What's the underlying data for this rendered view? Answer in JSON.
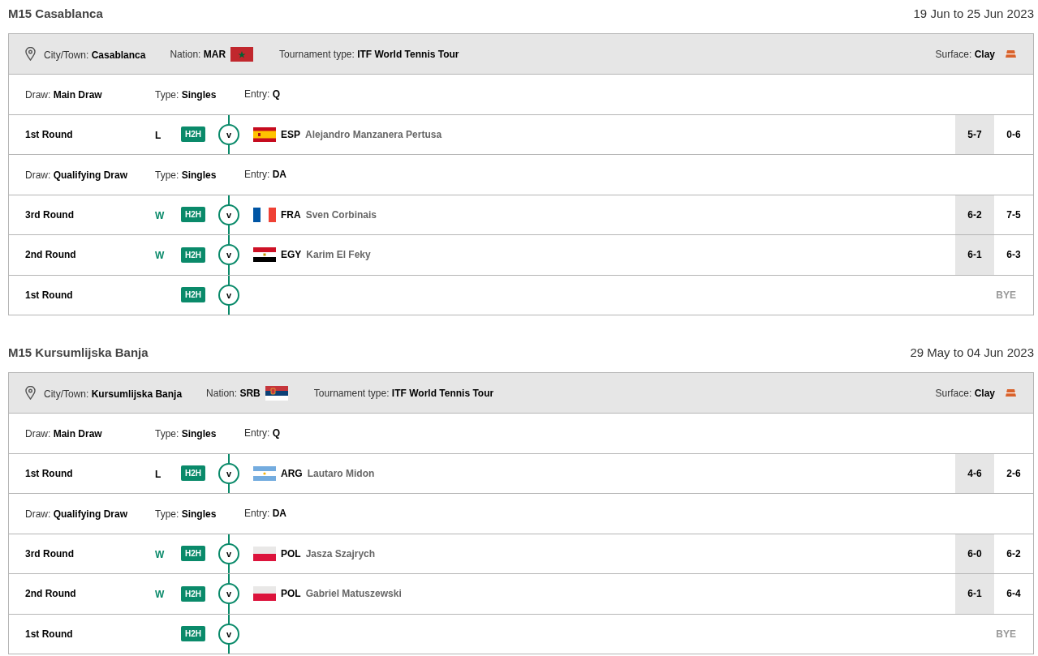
{
  "tournaments": [
    {
      "title": "M15 Casablanca",
      "dates": "19 Jun to 25 Jun 2023",
      "info": {
        "city": {
          "label": "City/Town:",
          "value": "Casablanca"
        },
        "nation": {
          "label": "Nation:",
          "value": "MAR",
          "flag": {
            "kind": "mar"
          }
        },
        "type": {
          "label": "Tournament type:",
          "value": "ITF World Tennis Tour"
        },
        "surface": {
          "label": "Surface:",
          "value": "Clay"
        }
      },
      "rows": [
        {
          "kind": "draw",
          "draw": {
            "label": "Draw:",
            "value": "Main Draw"
          },
          "type": {
            "label": "Type:",
            "value": "Singles"
          },
          "entry": {
            "label": "Entry:",
            "value": "Q"
          }
        },
        {
          "kind": "match",
          "round": "1st Round",
          "result": "L",
          "won": false,
          "h2h": "H2H",
          "vs": "v",
          "flag": {
            "kind": "esp"
          },
          "code": "ESP",
          "opponent": "Alejandro Manzanera Pertusa",
          "sets": [
            {
              "score": "5-7",
              "shaded": true
            },
            {
              "score": "0-6",
              "shaded": false
            }
          ]
        },
        {
          "kind": "draw",
          "draw": {
            "label": "Draw:",
            "value": "Qualifying Draw"
          },
          "type": {
            "label": "Type:",
            "value": "Singles"
          },
          "entry": {
            "label": "Entry:",
            "value": "DA"
          }
        },
        {
          "kind": "match",
          "round": "3rd Round",
          "result": "W",
          "won": true,
          "h2h": "H2H",
          "vs": "v",
          "flag": {
            "kind": "fra"
          },
          "code": "FRA",
          "opponent": "Sven Corbinais",
          "sets": [
            {
              "score": "6-2",
              "shaded": true
            },
            {
              "score": "7-5",
              "shaded": false
            }
          ]
        },
        {
          "kind": "match",
          "round": "2nd Round",
          "result": "W",
          "won": true,
          "h2h": "H2H",
          "vs": "v",
          "flag": {
            "kind": "egy"
          },
          "code": "EGY",
          "opponent": "Karim El Feky",
          "sets": [
            {
              "score": "6-1",
              "shaded": true
            },
            {
              "score": "6-3",
              "shaded": false
            }
          ]
        },
        {
          "kind": "bye",
          "round": "1st Round",
          "h2h": "H2H",
          "vs": "v",
          "bye": "BYE"
        }
      ]
    },
    {
      "title": "M15 Kursumlijska Banja",
      "dates": "29 May to 04 Jun 2023",
      "info": {
        "city": {
          "label": "City/Town:",
          "value": "Kursumlijska Banja"
        },
        "nation": {
          "label": "Nation:",
          "value": "SRB",
          "flag": {
            "kind": "srb"
          }
        },
        "type": {
          "label": "Tournament type:",
          "value": "ITF World Tennis Tour"
        },
        "surface": {
          "label": "Surface:",
          "value": "Clay"
        }
      },
      "rows": [
        {
          "kind": "draw",
          "draw": {
            "label": "Draw:",
            "value": "Main Draw"
          },
          "type": {
            "label": "Type:",
            "value": "Singles"
          },
          "entry": {
            "label": "Entry:",
            "value": "Q"
          }
        },
        {
          "kind": "match",
          "round": "1st Round",
          "result": "L",
          "won": false,
          "h2h": "H2H",
          "vs": "v",
          "flag": {
            "kind": "arg"
          },
          "code": "ARG",
          "opponent": "Lautaro Midon",
          "sets": [
            {
              "score": "4-6",
              "shaded": true
            },
            {
              "score": "2-6",
              "shaded": false
            }
          ]
        },
        {
          "kind": "draw",
          "draw": {
            "label": "Draw:",
            "value": "Qualifying Draw"
          },
          "type": {
            "label": "Type:",
            "value": "Singles"
          },
          "entry": {
            "label": "Entry:",
            "value": "DA"
          }
        },
        {
          "kind": "match",
          "round": "3rd Round",
          "result": "W",
          "won": true,
          "h2h": "H2H",
          "vs": "v",
          "flag": {
            "kind": "pol"
          },
          "code": "POL",
          "opponent": "Jasza Szajrych",
          "sets": [
            {
              "score": "6-0",
              "shaded": true
            },
            {
              "score": "6-2",
              "shaded": false
            }
          ]
        },
        {
          "kind": "match",
          "round": "2nd Round",
          "result": "W",
          "won": true,
          "h2h": "H2H",
          "vs": "v",
          "flag": {
            "kind": "pol"
          },
          "code": "POL",
          "opponent": "Gabriel Matuszewski",
          "sets": [
            {
              "score": "6-1",
              "shaded": true
            },
            {
              "score": "6-4",
              "shaded": false
            }
          ]
        },
        {
          "kind": "bye",
          "round": "1st Round",
          "h2h": "H2H",
          "vs": "v",
          "bye": "BYE"
        }
      ]
    }
  ]
}
